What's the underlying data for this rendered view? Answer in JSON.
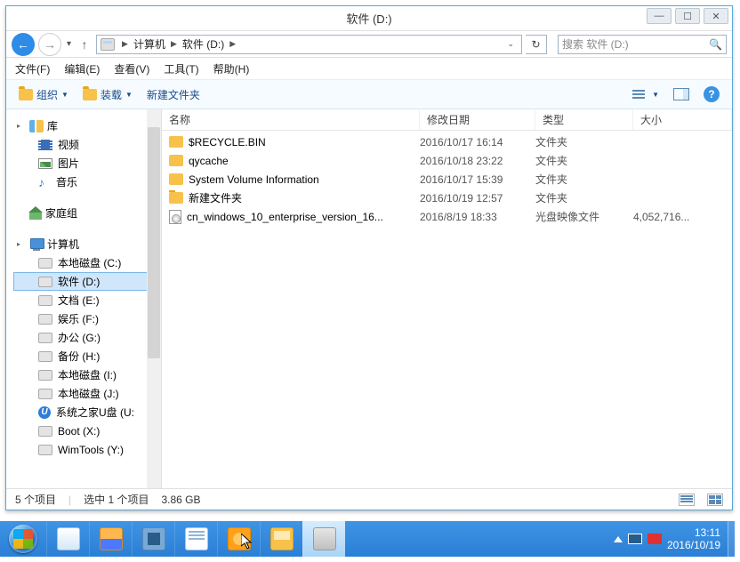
{
  "window": {
    "title": "软件 (D:)"
  },
  "nav": {
    "crumb_computer": "计算机",
    "crumb_drive": "软件 (D:)",
    "search_placeholder": "搜索 软件 (D:)"
  },
  "menu": {
    "file": "文件(F)",
    "edit": "编辑(E)",
    "view": "查看(V)",
    "tools": "工具(T)",
    "help": "帮助(H)"
  },
  "toolbar": {
    "organize": "组织",
    "mount": "装载",
    "newfolder": "新建文件夹"
  },
  "columns": {
    "name": "名称",
    "date": "修改日期",
    "type": "类型",
    "size": "大小"
  },
  "sidebar": {
    "libraries": {
      "label": "库",
      "video": "视频",
      "pictures": "图片",
      "music": "音乐"
    },
    "homegroup": "家庭组",
    "computer": {
      "label": "计算机",
      "items": [
        {
          "label": "本地磁盘 (C:)"
        },
        {
          "label": "软件 (D:)"
        },
        {
          "label": "文档 (E:)"
        },
        {
          "label": "娱乐 (F:)"
        },
        {
          "label": "办公 (G:)"
        },
        {
          "label": "备份 (H:)"
        },
        {
          "label": "本地磁盘 (I:)"
        },
        {
          "label": "本地磁盘 (J:)"
        },
        {
          "label": "系统之家U盘 (U:"
        },
        {
          "label": "Boot (X:)"
        },
        {
          "label": "WimTools (Y:)"
        }
      ]
    }
  },
  "files": [
    {
      "name": "$RECYCLE.BIN",
      "date": "2016/10/17 16:14",
      "type": "文件夹",
      "size": "",
      "icon": "folder"
    },
    {
      "name": "qycache",
      "date": "2016/10/18 23:22",
      "type": "文件夹",
      "size": "",
      "icon": "folder"
    },
    {
      "name": "System Volume Information",
      "date": "2016/10/17 15:39",
      "type": "文件夹",
      "size": "",
      "icon": "folder"
    },
    {
      "name": "新建文件夹",
      "date": "2016/10/19 12:57",
      "type": "文件夹",
      "size": "",
      "icon": "folder"
    },
    {
      "name": "cn_windows_10_enterprise_version_16...",
      "date": "2016/8/19 18:33",
      "type": "光盘映像文件",
      "size": "4,052,716...",
      "icon": "iso"
    }
  ],
  "status": {
    "count": "5 个项目",
    "selected": "选中 1 个项目",
    "size": "3.86 GB"
  },
  "tray": {
    "time": "13:11",
    "date": "2016/10/19"
  }
}
